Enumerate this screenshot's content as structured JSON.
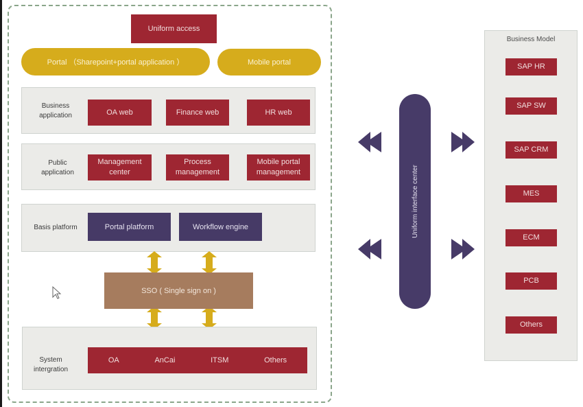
{
  "diagram": {
    "uniform_access": "Uniform access",
    "portals": [
      {
        "label": "Portal （Sharepoint+portal application ）"
      },
      {
        "label": "Mobile portal"
      }
    ],
    "business_application": {
      "label": "Business application",
      "items": [
        "OA web",
        "Finance web",
        "HR web"
      ]
    },
    "public_application": {
      "label": "Public application",
      "items": [
        "Management center",
        "Process management",
        "Mobile portal management"
      ]
    },
    "basis_platform": {
      "label": "Basis platform",
      "items": [
        "Portal platform",
        "Workflow engine"
      ]
    },
    "sso": "SSO ( Single sign on )",
    "system_integration": {
      "label": "System intergration",
      "items": [
        "OA",
        "AnCai",
        "ITSM",
        "Others"
      ]
    },
    "interface_center": "Uniform interface center",
    "business_model": {
      "title": "Business Model",
      "items": [
        "SAP HR",
        "SAP SW",
        "SAP CRM",
        "MES",
        "ECM",
        "PCB",
        "Others"
      ]
    }
  },
  "colors": {
    "red": "#9e2632",
    "gold": "#d6ac1c",
    "purple": "#463a66",
    "sso_brown": "#a67c5e",
    "panel_gray": "#ebebe8",
    "dashed_border": "#8aa58a"
  }
}
